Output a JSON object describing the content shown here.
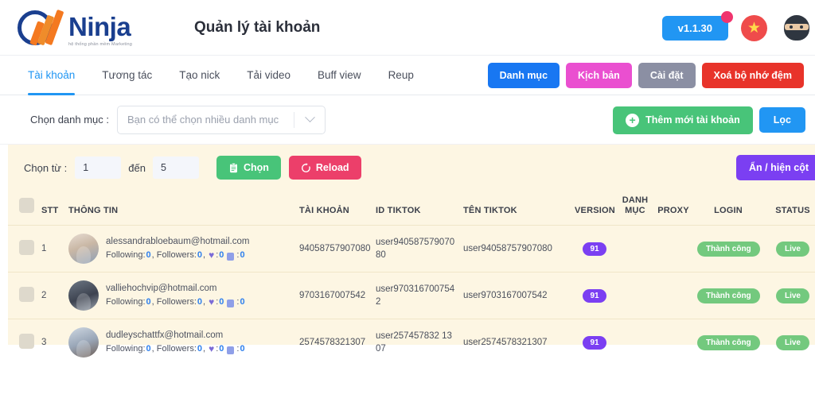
{
  "header": {
    "brand_name": "Ninja",
    "brand_subtitle": "hệ thống phần mềm Marketing",
    "page_title": "Quản lý tài khoản",
    "version_label": "v1.1.30",
    "flag_icon": "vietnam-flag-icon",
    "avatar_icon": "ninja-avatar-icon"
  },
  "nav": {
    "tabs": [
      {
        "label": "Tài khoản",
        "active": true
      },
      {
        "label": "Tương tác",
        "active": false
      },
      {
        "label": "Tạo nick",
        "active": false
      },
      {
        "label": "Tải video",
        "active": false
      },
      {
        "label": "Buff view",
        "active": false
      },
      {
        "label": "Reup",
        "active": false
      }
    ],
    "actions": [
      {
        "label": "Danh mục",
        "color": "#1877f2"
      },
      {
        "label": "Kịch bản",
        "color": "#ea4fd0"
      },
      {
        "label": "Cài đặt",
        "color": "#8b8fa3"
      },
      {
        "label": "Xoá bộ nhớ đệm",
        "color": "#e8332a"
      }
    ]
  },
  "filter": {
    "label": "Chọn danh mục :",
    "select_placeholder": "Bạn có thể chọn nhiều danh mục",
    "add_button": "Thêm mới tài khoản",
    "filter_button": "Lọc"
  },
  "toolbar": {
    "from_label": "Chọn từ :",
    "from_value": "1",
    "to_label": "đến",
    "to_value": "5",
    "select_button": "Chọn",
    "reload_button": "Reload",
    "columns_button": "Ẩn / hiện cột"
  },
  "table": {
    "headers": {
      "stt": "STT",
      "info": "THÔNG TIN",
      "account": "TÀI KHOẢN",
      "id_tiktok": "ID TIKTOK",
      "name_tiktok": "TÊN TIKTOK",
      "version": "VERSION",
      "category_line1": "DANH",
      "category_line2": "MỤC",
      "proxy": "PROXY",
      "login": "LOGIN",
      "status": "STATUS"
    },
    "stats_prefix": "Following:",
    "stats_mid": ", Followers:",
    "rows": [
      {
        "stt": "1",
        "email": "alessandrabloebaum@hotmail.com",
        "following": "0",
        "followers": "0",
        "likes": "0",
        "videos": "0",
        "account": "94058757907080",
        "id_tiktok": "user94058757907080",
        "name_tiktok": "user94058757907080",
        "version": "91",
        "category": "",
        "proxy": "",
        "login": "Thành công",
        "status": "Live"
      },
      {
        "stt": "2",
        "email": "valliehochvip@hotmail.com",
        "following": "0",
        "followers": "0",
        "likes": "0",
        "videos": "0",
        "account": "9703167007542",
        "id_tiktok": "user9703167007542",
        "name_tiktok": "user9703167007542",
        "version": "91",
        "category": "",
        "proxy": "",
        "login": "Thành công",
        "status": "Live"
      },
      {
        "stt": "3",
        "email": "dudleyschattfx@hotmail.com",
        "following": "0",
        "followers": "0",
        "likes": "0",
        "videos": "0",
        "account": "2574578321307",
        "id_tiktok": "user257457832 1307",
        "name_tiktok": "user2574578321307",
        "version": "91",
        "category": "",
        "proxy": "",
        "login": "Thành công",
        "status": "Live"
      }
    ]
  },
  "colors": {
    "accent_blue": "#2196f3",
    "green": "#48c479",
    "pink": "#ec3f6a",
    "purple": "#7b3ff2",
    "red": "#e8332a",
    "magenta": "#ea4fd0",
    "table_bg": "#fdf6e3"
  }
}
